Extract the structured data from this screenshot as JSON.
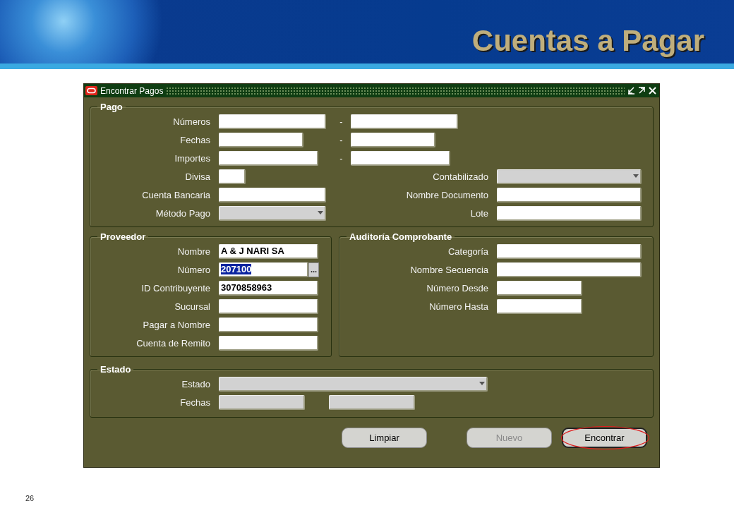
{
  "slide": {
    "title": "Cuentas a Pagar",
    "page_number": "26"
  },
  "window": {
    "title": "Encontrar Pagos"
  },
  "pago": {
    "title": "Pago",
    "rows": [
      {
        "label": "Números",
        "field": {
          "kind": "text"
        },
        "range_to": {
          "separator": "-",
          "field": {
            "kind": "text"
          }
        }
      },
      {
        "label": "Fechas",
        "field": {
          "kind": "text"
        },
        "range_to": {
          "separator": "-",
          "field": {
            "kind": "text"
          }
        }
      },
      {
        "label": "Importes",
        "field": {
          "kind": "text"
        },
        "range_to": {
          "separator": "-",
          "field": {
            "kind": "text"
          }
        }
      },
      {
        "label": "Divisa",
        "field": {
          "kind": "text"
        },
        "right": {
          "label": "Contabilizado",
          "field": {
            "kind": "select"
          }
        }
      },
      {
        "label": "Cuenta Bancaria",
        "field": {
          "kind": "text"
        },
        "right": {
          "label": "Nombre Documento",
          "field": {
            "kind": "text"
          }
        }
      },
      {
        "label": "Método Pago",
        "field": {
          "kind": "select"
        },
        "right": {
          "label": "Lote",
          "field": {
            "kind": "text"
          }
        }
      }
    ]
  },
  "proveedor": {
    "title": "Proveedor",
    "rows": [
      {
        "label": "Nombre",
        "field": {
          "kind": "text",
          "value": "A & J NARI SA",
          "highlighted": false
        }
      },
      {
        "label": "Número",
        "field": {
          "kind": "lov",
          "value": "207100",
          "highlighted": true,
          "button": "..."
        }
      },
      {
        "label": "ID Contribuyente",
        "field": {
          "kind": "text",
          "value": "3070858963",
          "highlighted": false
        }
      },
      {
        "label": "Sucursal",
        "field": {
          "kind": "text"
        }
      },
      {
        "label": "Pagar a Nombre",
        "field": {
          "kind": "text"
        }
      },
      {
        "label": "Cuenta de Remito",
        "field": {
          "kind": "text"
        }
      }
    ]
  },
  "auditoria": {
    "title": "Auditoría Comprobante",
    "rows": [
      {
        "label": "Categoría",
        "field": {
          "kind": "text"
        }
      },
      {
        "label": "Nombre Secuencia",
        "field": {
          "kind": "text"
        }
      },
      {
        "label": "Número Desde",
        "field": {
          "kind": "text"
        }
      },
      {
        "label": "Número Hasta",
        "field": {
          "kind": "text"
        }
      }
    ]
  },
  "estado": {
    "title": "Estado",
    "rows": [
      {
        "label": "Estado",
        "fields": [
          {
            "kind": "select"
          }
        ]
      },
      {
        "label": "Fechas",
        "fields": [
          {
            "kind": "text",
            "disabled": true
          },
          {
            "kind": "text",
            "disabled": true
          }
        ]
      }
    ]
  },
  "buttons": [
    {
      "label": "Limpiar",
      "disabled": false,
      "selected": false,
      "annotated": false
    },
    {
      "label": "Nuevo",
      "disabled": true,
      "selected": false,
      "annotated": false
    },
    {
      "label": "Encontrar",
      "disabled": false,
      "selected": true,
      "annotated": true
    }
  ]
}
